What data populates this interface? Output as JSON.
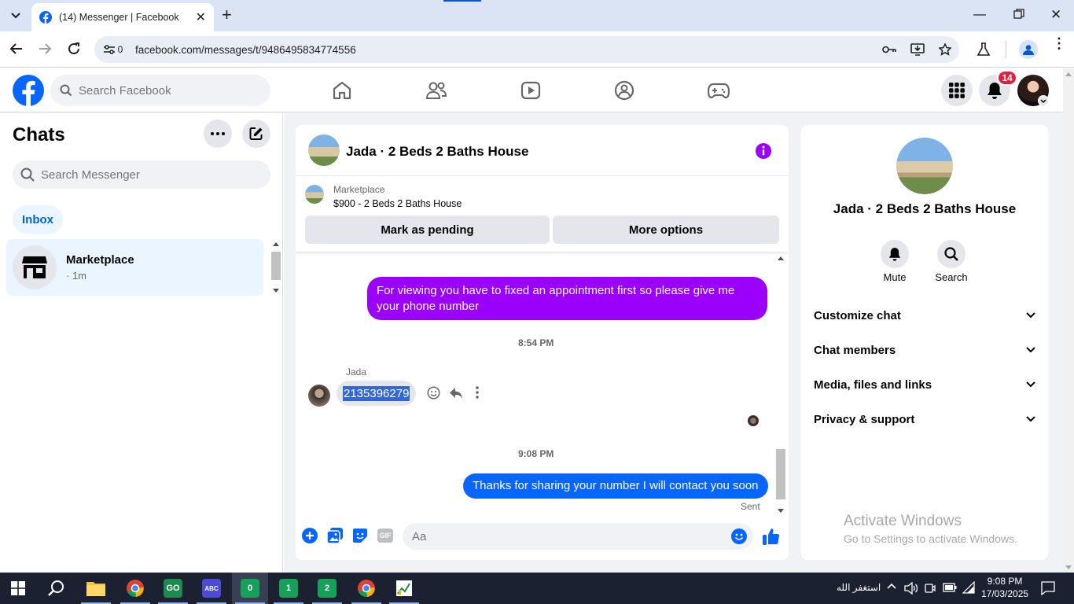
{
  "browser": {
    "tab_title": "(14) Messenger | Facebook",
    "tab_count": "0",
    "url": "facebook.com/messages/t/9486495834774556"
  },
  "fb": {
    "search_placeholder": "Search Facebook",
    "notification_count": "14"
  },
  "chats": {
    "title": "Chats",
    "search_placeholder": "Search Messenger",
    "filter_label": "Inbox",
    "items": [
      {
        "name": "Marketplace",
        "meta": "· 1m"
      }
    ]
  },
  "conversation": {
    "title": "Jada · 2 Beds 2 Baths House",
    "marketplace_label": "Marketplace",
    "listing": "$900 - 2 Beds 2 Baths House",
    "mark_pending_label": "Mark as pending",
    "more_options_label": "More options",
    "messages": [
      {
        "text": "For viewing you have to fixed an appointment first so please give me your phone number"
      },
      {
        "time": "8:54 PM"
      },
      {
        "sender": "Jada",
        "text": "2135396279"
      },
      {
        "time": "9:08 PM"
      },
      {
        "text": "Thanks for sharing your number I will contact you soon",
        "status": "Sent"
      }
    ],
    "composer_placeholder": "Aa"
  },
  "details": {
    "title": "Jada · 2 Beds 2 Baths House",
    "mute_label": "Mute",
    "search_label": "Search",
    "sections": [
      "Customize chat",
      "Chat members",
      "Media, files and links",
      "Privacy & support"
    ]
  },
  "watermark": {
    "line1": "Activate Windows",
    "line2": "Go to Settings to activate Windows."
  },
  "taskbar": {
    "lang_text": "استغفر الله",
    "time": "9:08 PM",
    "date": "17/03/2025",
    "app_badges": [
      "0",
      "1",
      "2"
    ]
  },
  "colors": {
    "fb_blue": "#0866ff",
    "messenger_purple": "#9a00fb",
    "notification_red": "#e41e3f"
  }
}
